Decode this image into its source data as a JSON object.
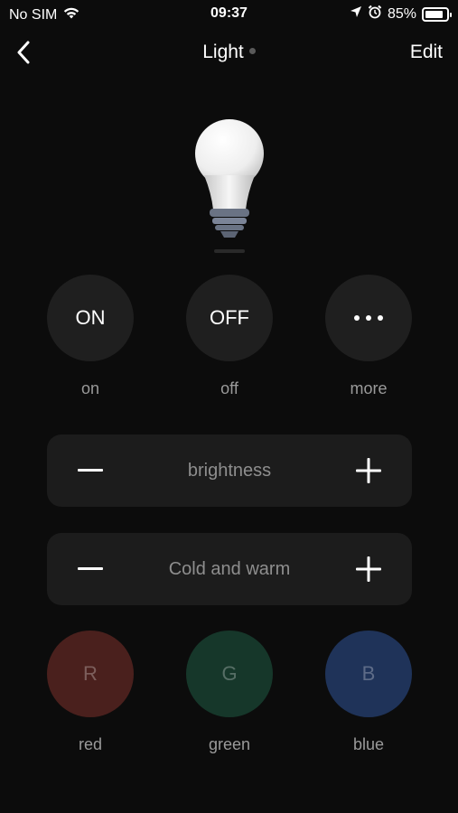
{
  "status_bar": {
    "carrier": "No SIM",
    "time": "09:37",
    "battery": "85%",
    "battery_level": 0.85
  },
  "nav": {
    "title": "Light",
    "edit_label": "Edit"
  },
  "power": {
    "on_button": "ON",
    "on_label": "on",
    "off_button": "OFF",
    "off_label": "off",
    "more_label": "more"
  },
  "adjust": {
    "brightness_label": "brightness",
    "temperature_label": "Cold and warm"
  },
  "colors": {
    "red_button": "R",
    "red_label": "red",
    "red_color": "#4a201d",
    "green_button": "G",
    "green_label": "green",
    "green_color": "#16372a",
    "blue_button": "B",
    "blue_label": "blue",
    "blue_color": "#1f3359"
  }
}
